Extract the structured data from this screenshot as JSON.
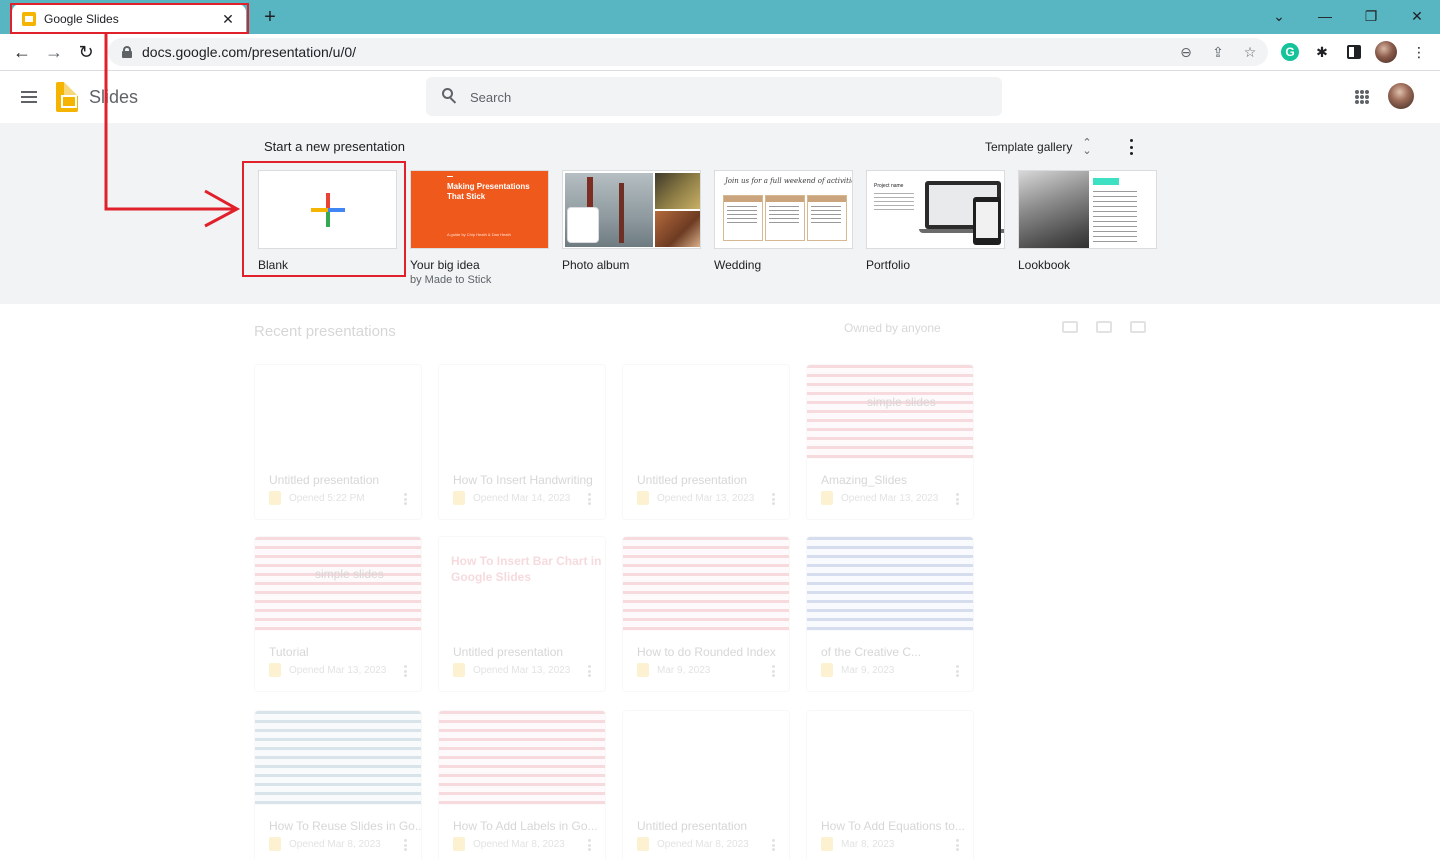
{
  "browser": {
    "tab_title": "Google Slides",
    "tab_close_glyph": "✕",
    "new_tab_glyph": "+",
    "url": "docs.google.com/presentation/u/0/",
    "nav": {
      "back_glyph": "←",
      "forward_glyph": "→",
      "reload_glyph": "↻"
    },
    "window": {
      "dropdown_glyph": "⌄",
      "minimize_glyph": "—",
      "restore_glyph": "❐",
      "close_glyph": "✕"
    },
    "omnibox_icons": {
      "zoom_glyph": "⊖",
      "share_glyph": "⇪",
      "star_glyph": "☆"
    },
    "extensions": {
      "grammarly_glyph": "G",
      "puzzle_glyph": "✱"
    }
  },
  "app": {
    "name": "Slides",
    "search": {
      "placeholder": "Search"
    }
  },
  "new_presentation": {
    "heading": "Start a new presentation",
    "gallery_label": "Template gallery",
    "templates": [
      {
        "label": "Blank"
      },
      {
        "label": "Your big idea",
        "sub": "by Made to Stick",
        "thumb_title": "Making Presentations That Stick",
        "thumb_sub": "A guide by Chip Heath & Dan Heath"
      },
      {
        "label": "Photo album"
      },
      {
        "label": "Wedding",
        "thumb_title": "Join us for a full weekend of activities!"
      },
      {
        "label": "Portfolio",
        "thumb_title": "Project name"
      },
      {
        "label": "Lookbook"
      }
    ]
  },
  "recent": {
    "heading": "Recent presentations",
    "owner_filter": "Owned by anyone",
    "cards": [
      {
        "title": "Untitled presentation",
        "date": "Opened 5:22 PM"
      },
      {
        "title": "How To Insert Handwriting",
        "date": "Opened Mar 14, 2023"
      },
      {
        "title": "Untitled presentation",
        "date": "Opened Mar 13, 2023"
      },
      {
        "title": "Amazing_Slides",
        "date": "Opened Mar 13, 2023",
        "thumb_text": "simple slides"
      },
      {
        "title": "Tutorial",
        "date": "Opened Mar 13, 2023",
        "thumb_text": "simple slides"
      },
      {
        "title": "Untitled presentation",
        "date": "Opened Mar 13, 2023",
        "thumb_text": "How To Insert Bar Chart in Google Slides"
      },
      {
        "title": "How to do Rounded Index",
        "date": "Mar 9, 2023"
      },
      {
        "title": "of the Creative C...",
        "date": "Mar 9, 2023"
      },
      {
        "title": "How To Reuse Slides in Go...",
        "date": "Opened Mar 8, 2023"
      },
      {
        "title": "How To Add Labels in Go...",
        "date": "Opened Mar 8, 2023"
      },
      {
        "title": "Untitled presentation",
        "date": "Opened Mar 8, 2023"
      },
      {
        "title": "How To Add Equations to...",
        "date": "Mar 8, 2023"
      }
    ]
  },
  "colors": {
    "tabbar": "#57b6c2",
    "annotation_red": "#e0202a",
    "slides_yellow": "#f4b400",
    "template_orange": "#f0591c"
  }
}
